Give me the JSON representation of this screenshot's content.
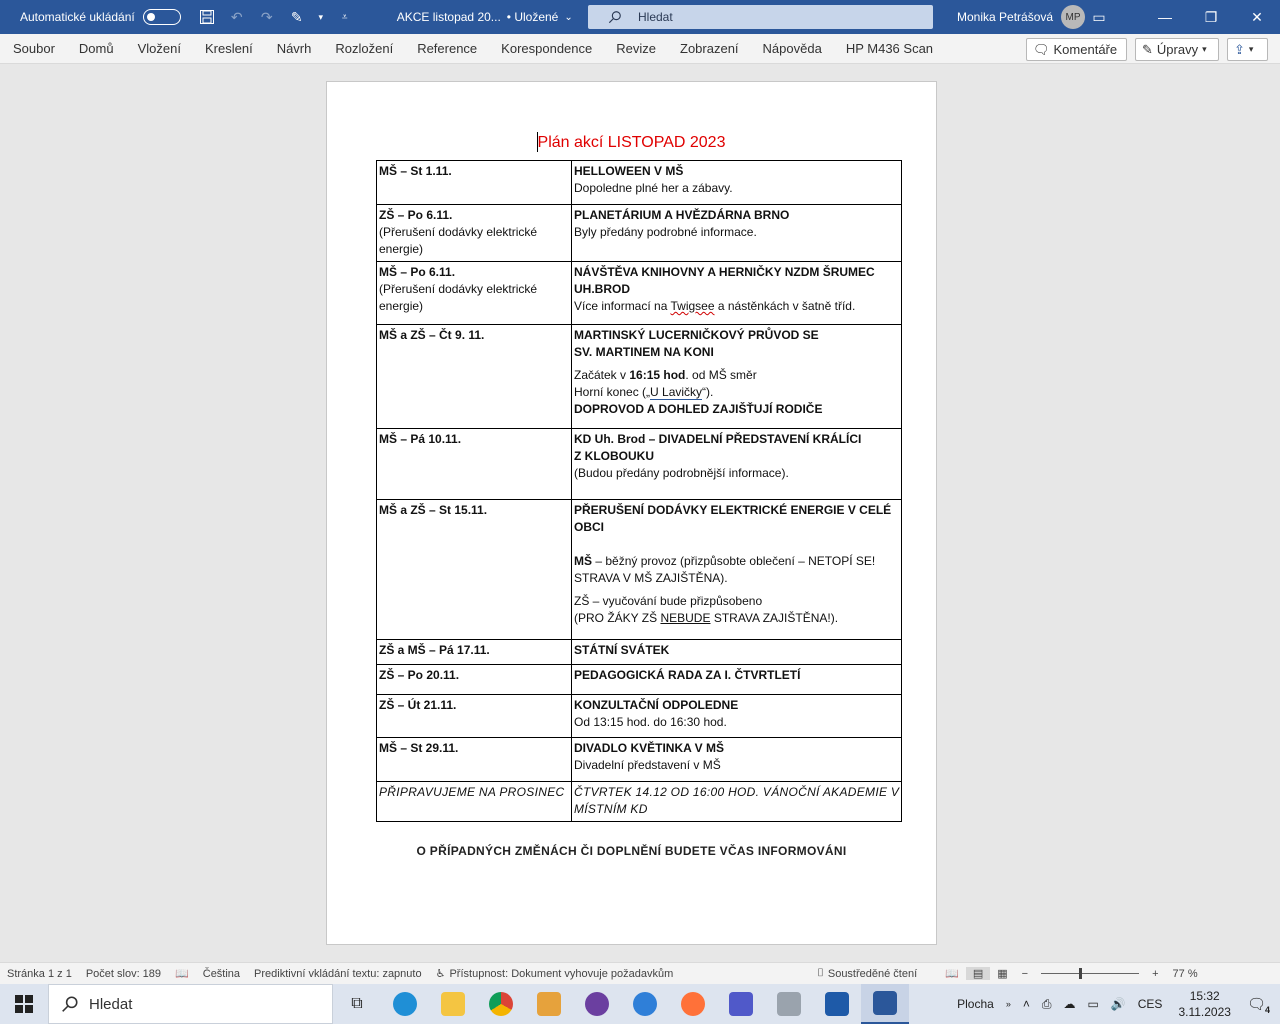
{
  "titlebar": {
    "autosave_label": "Automatické ukládání",
    "doc_title": "AKCE listopad 20...",
    "saved_status": "• Uložené",
    "search_placeholder": "Hledat",
    "user_name": "Monika Petrášová",
    "user_initials": "MP"
  },
  "menu": {
    "items": [
      "Soubor",
      "Domů",
      "Vložení",
      "Kreslení",
      "Návrh",
      "Rozložení",
      "Reference",
      "Korespondence",
      "Revize",
      "Zobrazení",
      "Nápověda",
      "HP M436 Scan"
    ],
    "comments_label": "Komentáře",
    "editing_label": "Úpravy"
  },
  "document": {
    "heading": "Plán akcí LISTOPAD 2023",
    "rows": [
      {
        "c1_bold": "MŠ – St 1.11.",
        "c1_note": "",
        "c2_title": "HELLOWEEN V MŠ",
        "c2_text": "Dopoledne plné her a zábavy."
      },
      {
        "c1_bold": "ZŠ – Po 6.11.",
        "c1_note": "(Přerušení dodávky elektrické energie)",
        "c2_title": "PLANETÁRIUM A HVĚZDÁRNA BRNO",
        "c2_text": "Byly předány podrobné informace."
      },
      {
        "c1_bold": "MŠ – Po 6.11.",
        "c1_note": "(Přerušení dodávky elektrické energie)",
        "c2_title": "NÁVŠTĚVA KNIHOVNY A HERNIČKY NZDM ŠRUMEC UH.BROD",
        "c2_text_a": "Více informací na ",
        "c2_text_spell": "Twigsee",
        "c2_text_b": " a nástěnkách v šatně tříd."
      },
      {
        "c1_bold": "MŠ a ZŠ – Čt 9. 11.",
        "c2_title_1": "MARTINSKÝ LUCERNIČKOVÝ PRŮVOD SE",
        "c2_title_2": "SV. MARTINEM NA KONI",
        "c2_start_a": "Začátek v ",
        "c2_start_b": "16:15 hod",
        "c2_start_c": ". od MŠ směr",
        "c2_place_a": "Horní konec („",
        "c2_place_link": "U Lavičky",
        "c2_place_b": "“).",
        "c2_bold_end": "DOPROVOD A DOHLED ZAJIŠŤUJÍ RODIČE"
      },
      {
        "c1_bold": "MŠ – Pá 10.11.",
        "c2_title_1": "KD Uh. Brod – DIVADELNÍ PŘEDSTAVENÍ KRÁLÍCI",
        "c2_title_2": "Z KLOBOUKU",
        "c2_text": "(Budou předány podrobnější informace)."
      },
      {
        "c1_bold": "MŠ a ZŠ – St 15.11.",
        "c2_title": "PŘERUŠENÍ DODÁVKY ELEKTRICKÉ ENERGIE V CELÉ OBCI",
        "c2_ms_bold": "MŠ",
        "c2_ms_text": " – běžný provoz (přizpůsobte oblečení – NETOPÍ SE! STRAVA V MŠ ZAJIŠTĚNA).",
        "c2_zs_a": "ZŠ – vyučování bude přizpůsobeno",
        "c2_zs_b": "(PRO ŽÁKY ZŠ ",
        "c2_zs_ul": "NEBUDE",
        "c2_zs_c": " STRAVA ZAJIŠTĚNA!)."
      },
      {
        "c1_bold": "ZŠ a MŠ – Pá 17.11.",
        "c2_title": "STÁTNÍ SVÁTEK"
      },
      {
        "c1_bold": "ZŠ – Po 20.11.",
        "c2_title": "PEDAGOGICKÁ RADA ZA I. ČTVRTLETÍ"
      },
      {
        "c1_bold": "ZŠ – Út 21.11.",
        "c2_title": "KONZULTAČNÍ ODPOLEDNE",
        "c2_text": "Od 13:15 hod. do 16:30 hod."
      },
      {
        "c1_bold": "MŠ – St 29.11.",
        "c2_title": "DIVADLO KVĚTINKA V MŠ",
        "c2_text": "Divadelní představení v MŠ"
      },
      {
        "c1_ital": "PŘIPRAVUJEME NA PROSINEC",
        "c2_ital": "ČTVRTEK 14.12 OD 16:00 HOD. VÁNOČNÍ AKADEMIE V MÍSTNÍM KD"
      }
    ],
    "footer_note": "O PŘÍPADNÝCH ZMĚNÁCH ČI DOPLNĚNÍ BUDETE VČAS INFORMOVÁNI"
  },
  "statusbar": {
    "page": "Stránka 1 z 1",
    "words": "Počet slov: 189",
    "language": "Čeština",
    "predictive": "Prediktivní vkládání textu: zapnuto",
    "accessibility": "Přístupnost: Dokument vyhovuje požadavkům",
    "focus": "Soustředěné čtení",
    "zoom": "77 %",
    "zoom_minus": "−",
    "zoom_plus": "+"
  },
  "taskbar": {
    "search_placeholder": "Hledat",
    "desktop_label": "Plocha",
    "language": "CES",
    "time": "15:32",
    "date": "3.11.2023",
    "notifications": "4"
  },
  "colors": {
    "word_blue": "#2b579a",
    "heading_red": "#e00000"
  }
}
